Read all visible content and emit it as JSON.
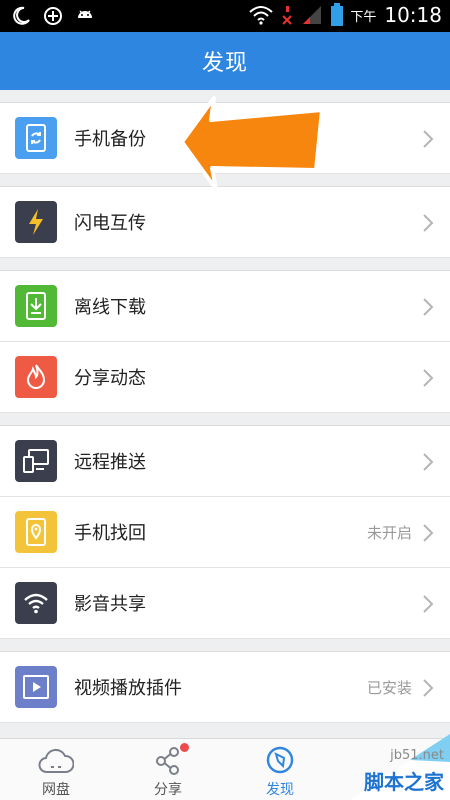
{
  "status_bar": {
    "ampm": "下午",
    "time": "10:18"
  },
  "header": {
    "title": "发现"
  },
  "groups": [
    {
      "items": [
        {
          "label": "手机备份",
          "value": "",
          "icon": "phone-backup-icon",
          "color": "#4a9ff0"
        }
      ]
    },
    {
      "items": [
        {
          "label": "闪电互传",
          "value": "",
          "icon": "lightning-icon",
          "color": "#3b3f4d"
        }
      ]
    },
    {
      "items": [
        {
          "label": "离线下载",
          "value": "",
          "icon": "offline-download-icon",
          "color": "#52b936"
        },
        {
          "label": "分享动态",
          "value": "",
          "icon": "flame-icon",
          "color": "#ef5a44"
        }
      ]
    },
    {
      "items": [
        {
          "label": "远程推送",
          "value": "",
          "icon": "remote-push-icon",
          "color": "#3b3f4d"
        },
        {
          "label": "手机找回",
          "value": "未开启",
          "icon": "phone-locate-icon",
          "color": "#f3c43a"
        },
        {
          "label": "影音共享",
          "value": "",
          "icon": "wifi-icon",
          "color": "#3b3f4d"
        }
      ]
    },
    {
      "items": [
        {
          "label": "视频播放插件",
          "value": "已安装",
          "icon": "video-play-icon",
          "color": "#6c7fc8"
        }
      ]
    }
  ],
  "tabs": [
    {
      "label": "网盘",
      "icon": "cloud-icon"
    },
    {
      "label": "分享",
      "icon": "share-icon"
    },
    {
      "label": "发现",
      "icon": "compass-icon"
    }
  ],
  "watermark": {
    "site": "jb51.net",
    "name": "脚本之家"
  }
}
